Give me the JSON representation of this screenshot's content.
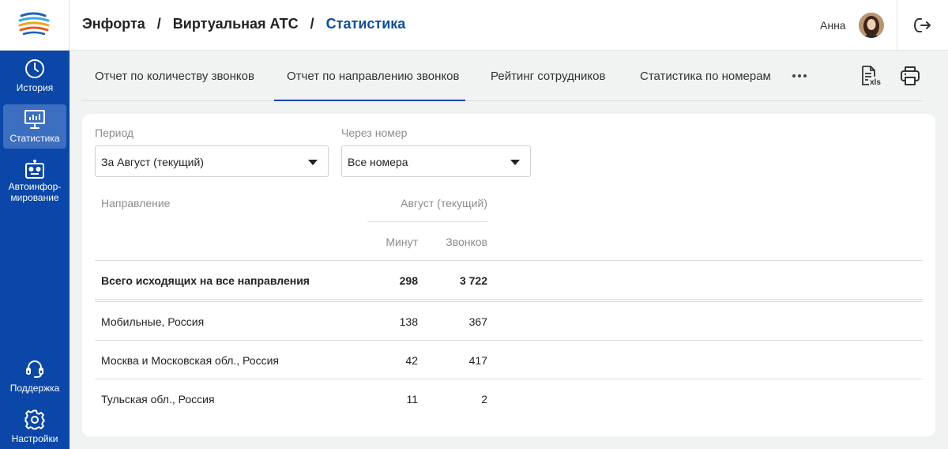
{
  "header": {
    "breadcrumb": [
      "Энфорта",
      "Виртуальная АТС",
      "Статистика"
    ],
    "separator": "/",
    "user_name": "Анна",
    "logo_icon": "enforta-logo-icon",
    "logout_icon": "logout-icon"
  },
  "sidebar": {
    "items": [
      {
        "label": "История",
        "icon": "clock-icon",
        "active": false
      },
      {
        "label": "Статистика",
        "icon": "chart-monitor-icon",
        "active": true
      },
      {
        "label": "Автоинфор-мирование",
        "label_line1": "Автоинфор-",
        "label_line2": "мирование",
        "icon": "robot-icon",
        "active": false
      },
      {
        "label": "Поддержка",
        "icon": "headset-icon",
        "active": false
      },
      {
        "label": "Настройки",
        "icon": "gear-icon",
        "active": false
      }
    ]
  },
  "tabs": {
    "items": [
      {
        "label": "Отчет по количеству звонков",
        "active": false
      },
      {
        "label": "Отчет по направлению звонков",
        "active": true
      },
      {
        "label": "Рейтинг сотрудников",
        "active": false
      },
      {
        "label": "Статистика по номерам",
        "active": false
      }
    ],
    "more_icon": "more-horizontal-icon",
    "export_icon": "xls-export-icon",
    "export_badge": "xls",
    "print_icon": "printer-icon"
  },
  "filters": {
    "period": {
      "label": "Период",
      "value": "За Август (текущий)"
    },
    "number": {
      "label": "Через номер",
      "value": "Все номера"
    }
  },
  "table": {
    "col_direction": "Направление",
    "col_group": "Август (текущий)",
    "col_minutes": "Минут",
    "col_calls": "Звонков",
    "total": {
      "label": "Всего исходящих на все направления",
      "minutes": "298",
      "calls": "3 722"
    },
    "rows": [
      {
        "label": "Мобильные, Россия",
        "minutes": "138",
        "calls": "367"
      },
      {
        "label": "Москва и Московская обл., Россия",
        "minutes": "42",
        "calls": "417"
      },
      {
        "label": "Тульская обл., Россия",
        "minutes": "11",
        "calls": "2"
      }
    ]
  },
  "colors": {
    "brand": "#0a47a9",
    "sidebar_active": "#3d6fc0",
    "active_text": "#0d4fa0",
    "background": "#f1f2f2"
  }
}
